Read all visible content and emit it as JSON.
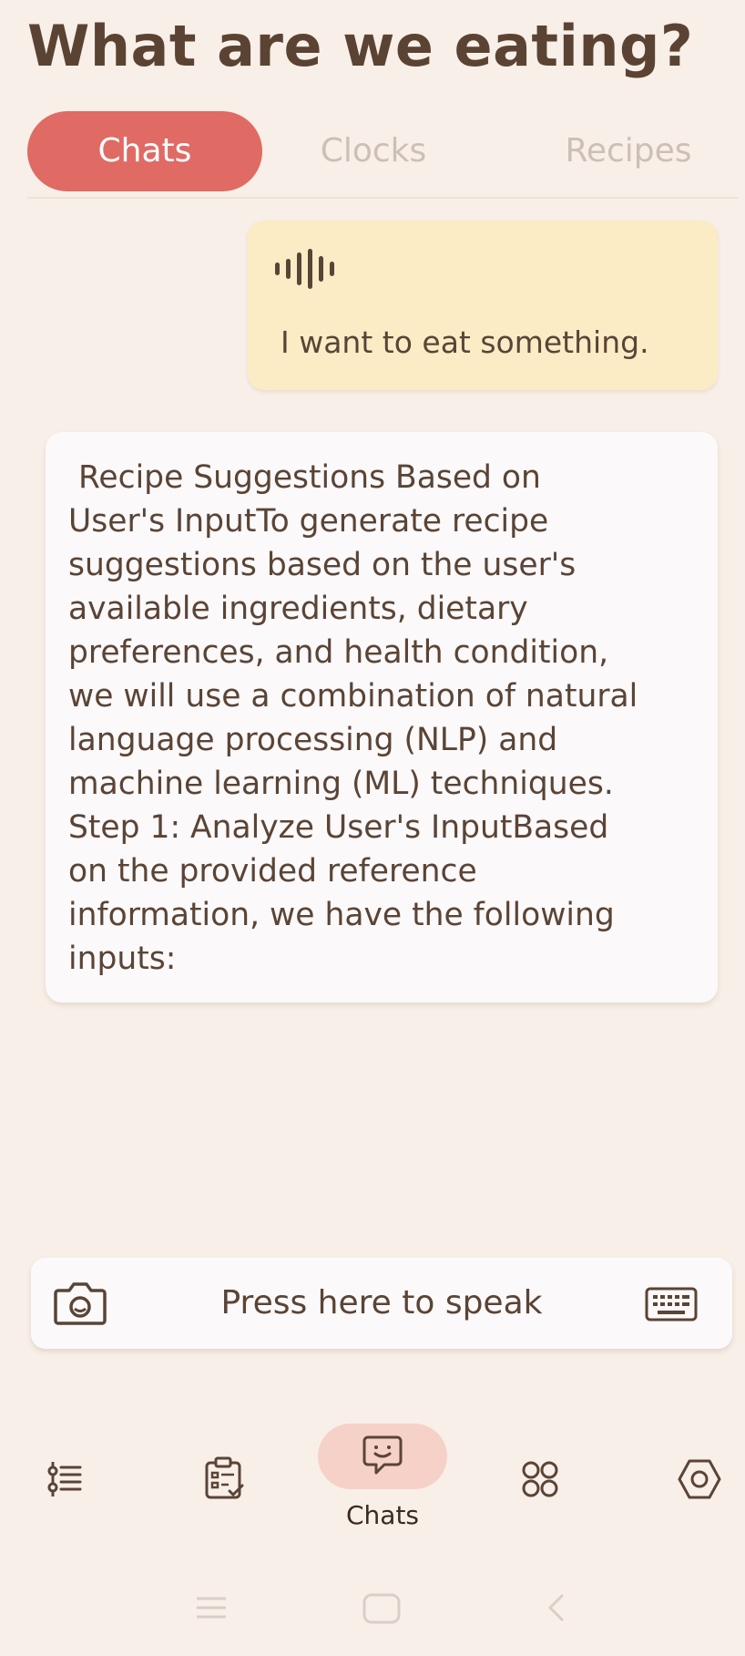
{
  "header": {
    "title": "What are we eating?"
  },
  "tabs": [
    {
      "label": "Chats",
      "active": true
    },
    {
      "label": "Clocks",
      "active": false
    },
    {
      "label": "Recipes",
      "active": false
    }
  ],
  "conversation": {
    "user_message": {
      "type": "voice",
      "text": "I want to eat something."
    },
    "bot_message": {
      "text": " Recipe Suggestions Based on\nUser's InputTo generate recipe\nsuggestions based on the user's\navailable ingredients, dietary\npreferences, and health condition,\nwe will use a combination of natural\nlanguage processing (NLP) and\nmachine learning (ML) techniques.\nStep 1: Analyze User's InputBased\non the provided reference\ninformation, we have the following\ninputs:"
    }
  },
  "input_bar": {
    "speak_label": "Press here to speak",
    "camera_icon": "camera-icon",
    "keyboard_icon": "keyboard-icon"
  },
  "bottom_nav": {
    "items": [
      {
        "icon": "list-icon",
        "label": ""
      },
      {
        "icon": "clipboard-icon",
        "label": ""
      },
      {
        "icon": "chat-icon",
        "label": "Chats",
        "active": true
      },
      {
        "icon": "grid-icon",
        "label": ""
      },
      {
        "icon": "settings-icon",
        "label": ""
      }
    ]
  },
  "colors": {
    "background": "#f8efe8",
    "accent": "#e06a64",
    "user_bubble": "#fbecc6",
    "bot_bubble": "#fbf9f9",
    "text": "#5a4436",
    "inactive_tab": "#cdbfb6",
    "nav_active_pill": "#f6d1c8"
  }
}
